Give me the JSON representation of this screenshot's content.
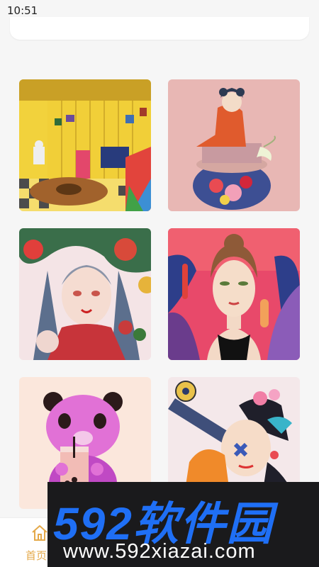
{
  "status_bar": {
    "time": "10:51"
  },
  "gallery": {
    "items": [
      {
        "name": "room"
      },
      {
        "name": "kimono-girl"
      },
      {
        "name": "flower-girl"
      },
      {
        "name": "woman-portrait"
      },
      {
        "name": "panda-bubble-tea"
      },
      {
        "name": "telescope-girl"
      }
    ]
  },
  "nav": {
    "home_label": "首页"
  },
  "watermark": {
    "logo": "592软件园",
    "url": "www.592xiazai.com"
  }
}
